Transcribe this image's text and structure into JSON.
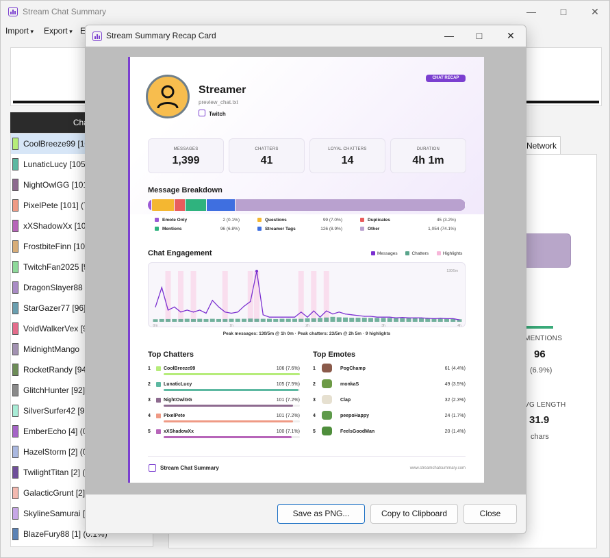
{
  "main": {
    "title": "Stream Chat Summary",
    "menu": [
      "Import",
      "Export",
      "E"
    ],
    "list_header": "Chat",
    "chatters": [
      {
        "label": "CoolBreeze99 [10",
        "color": "#b6ec7a"
      },
      {
        "label": "LunaticLucy [105]",
        "color": "#5cb8a1"
      },
      {
        "label": "NightOwlGG [101",
        "color": "#8d6a8f"
      },
      {
        "label": "PixelPete [101] (7.",
        "color": "#ef9a85"
      },
      {
        "label": "xXShadowXx [100",
        "color": "#b765b9"
      },
      {
        "label": "FrostbiteFinn [10",
        "color": "#d8ad78"
      },
      {
        "label": "TwitchFan2025 [9",
        "color": "#8fd99a"
      },
      {
        "label": "DragonSlayer88 [",
        "color": "#a98bc5"
      },
      {
        "label": "StarGazer77 [96] (",
        "color": "#6a9fb0"
      },
      {
        "label": "VoidWalkerVex [9",
        "color": "#e46c8b"
      },
      {
        "label": "MidnightMango",
        "color": "#a392b2"
      },
      {
        "label": "RocketRandy [94]",
        "color": "#6d8d58"
      },
      {
        "label": "GlitchHunter [92]",
        "color": "#8a8a8a"
      },
      {
        "label": "SilverSurfer42 [91",
        "color": "#a8ecd6"
      },
      {
        "label": "EmberEcho [4] (0",
        "color": "#a565c7"
      },
      {
        "label": "HazelStorm [2] (0",
        "color": "#aab8e0"
      },
      {
        "label": "TwilightTitan [2] (",
        "color": "#6f4f9a"
      },
      {
        "label": "GalacticGrunt [2]",
        "color": "#f3b9b0"
      },
      {
        "label": "SkylineSamurai [1",
        "color": "#c7a7e6"
      },
      {
        "label": "BlazeFury88 [1] (0.1%)",
        "color": "#5b82b5"
      }
    ],
    "tab_network": "Network",
    "stat_mentions_label": "MENTIONS",
    "stat_mentions_value": "96",
    "stat_mentions_sub": "(6.9%)",
    "stat_length_label": "VG LENGTH",
    "stat_length_value": "31.9",
    "stat_length_sub": "chars"
  },
  "dialog": {
    "title": "Stream Summary Recap Card",
    "buttons": {
      "save": "Save as PNG...",
      "copy": "Copy to Clipboard",
      "close": "Close"
    }
  },
  "card": {
    "streamer": "Streamer",
    "file": "preview_chat.txt",
    "platform": "Twitch",
    "badge": "CHAT RECAP",
    "metrics": [
      {
        "label": "MESSAGES",
        "value": "1,399"
      },
      {
        "label": "CHATTERS",
        "value": "41"
      },
      {
        "label": "LOYAL CHATTERS",
        "value": "14"
      },
      {
        "label": "DURATION",
        "value": "4h 1m"
      }
    ],
    "breakdown_title": "Message Breakdown",
    "breakdown": [
      {
        "name": "Emote Only",
        "value": "2 (0.1%)",
        "pct": 0.1,
        "color": "#9b59d6"
      },
      {
        "name": "Questions",
        "value": "99 (7.0%)",
        "pct": 7.0,
        "color": "#f4b731"
      },
      {
        "name": "Duplicates",
        "value": "45 (3.2%)",
        "pct": 3.2,
        "color": "#e85d5d"
      },
      {
        "name": "Mentions",
        "value": "96 (6.8%)",
        "pct": 6.8,
        "color": "#2fb37e"
      },
      {
        "name": "Streamer Tags",
        "value": "126 (8.9%)",
        "pct": 8.9,
        "color": "#3f6fe0"
      },
      {
        "name": "Other",
        "value": "1,054 (74.1%)",
        "pct": 74.1,
        "color": "#b9a1cf"
      }
    ],
    "engagement_title": "Chat Engagement",
    "engagement_legend": [
      {
        "name": "Messages",
        "color": "#7b2fd0"
      },
      {
        "name": "Chatters",
        "color": "#5aa58c"
      },
      {
        "name": "Highlights",
        "color": "#f7b6d9"
      }
    ],
    "engagement_ymax_label": "130/5m",
    "engagement_xticks": [
      "0m",
      "1h",
      "2h",
      "3h",
      "4h"
    ],
    "peak_text": "Peak messages: 130/5m @ 1h 0m   ·   Peak chatters: 23/5m @ 2h 5m   ·   9 highlights",
    "top_chatters_title": "Top Chatters",
    "top_chatters": [
      {
        "rank": "1",
        "name": "CoolBreeze99",
        "value": "106 (7.6%)",
        "share": 1.0,
        "color": "#b6ec7a"
      },
      {
        "rank": "2",
        "name": "LunaticLucy",
        "value": "105 (7.5%)",
        "share": 0.99,
        "color": "#5cb8a1"
      },
      {
        "rank": "3",
        "name": "NightOwlGG",
        "value": "101 (7.2%)",
        "share": 0.95,
        "color": "#8d6a8f"
      },
      {
        "rank": "4",
        "name": "PixelPete",
        "value": "101 (7.2%)",
        "share": 0.95,
        "color": "#ef9a85"
      },
      {
        "rank": "5",
        "name": "xXShadowXx",
        "value": "100 (7.1%)",
        "share": 0.94,
        "color": "#b765b9"
      }
    ],
    "top_emotes_title": "Top Emotes",
    "top_emotes": [
      {
        "rank": "1",
        "name": "PogChamp",
        "value": "61 (4.4%)",
        "color": "#8a5a4a"
      },
      {
        "rank": "2",
        "name": "monkaS",
        "value": "49 (3.5%)",
        "color": "#6c9a45"
      },
      {
        "rank": "3",
        "name": "Clap",
        "value": "32 (2.3%)",
        "color": "#e6e0d0"
      },
      {
        "rank": "4",
        "name": "peepoHappy",
        "value": "24 (1.7%)",
        "color": "#5e9a4a"
      },
      {
        "rank": "5",
        "name": "FeelsGoodMan",
        "value": "20 (1.4%)",
        "color": "#4f8e3c"
      }
    ],
    "footer_name": "Stream Chat Summary",
    "footer_url": "www.streamchatsummary.com"
  },
  "chart_data": {
    "type": "line",
    "title": "Chat Engagement",
    "xlabel": "",
    "ylabel": "",
    "x_ticks": [
      "0m",
      "1h",
      "2h",
      "3h",
      "4h"
    ],
    "ylim": [
      0,
      130
    ],
    "series": [
      {
        "name": "Messages",
        "values": [
          38,
          88,
          30,
          38,
          25,
          30,
          25,
          30,
          22,
          55,
          38,
          25,
          22,
          25,
          40,
          52,
          130,
          18,
          12,
          12,
          12,
          12,
          12,
          25,
          12,
          28,
          12,
          28,
          20,
          25,
          20,
          18,
          16,
          14,
          14,
          12,
          12,
          12,
          10,
          11,
          10,
          10,
          10,
          9,
          8,
          9,
          8,
          8,
          5
        ]
      },
      {
        "name": "Chatters",
        "values": [
          12,
          13,
          13,
          13,
          13,
          14,
          13,
          14,
          13,
          14,
          13,
          13,
          14,
          14,
          14,
          15,
          14,
          14,
          14,
          13,
          14,
          14,
          14,
          14,
          16,
          16,
          18,
          20,
          23,
          21,
          20,
          19,
          19,
          19,
          18,
          18,
          18,
          18,
          17,
          17,
          17,
          16,
          16,
          16,
          16,
          16,
          15,
          15,
          12
        ]
      }
    ],
    "highlights": [
      2,
      4,
      6,
      11,
      15,
      16,
      23,
      25,
      27
    ]
  }
}
